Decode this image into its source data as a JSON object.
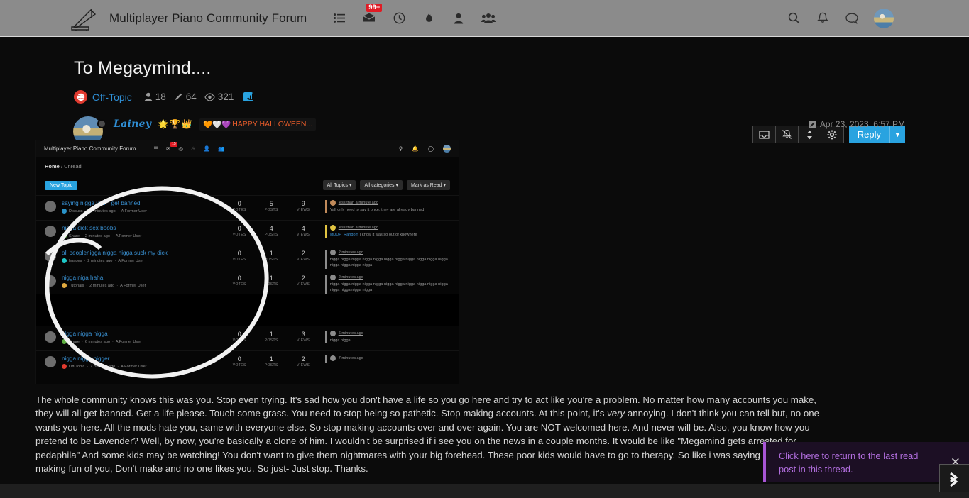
{
  "navbar": {
    "brand": "Multiplayer Piano Community Forum",
    "logo_icon": "piano-icon",
    "icons": [
      {
        "name": "list-icon",
        "glyph": "☰"
      },
      {
        "name": "unread-inbox-icon",
        "glyph": "✉",
        "badge": "99+"
      },
      {
        "name": "recent-clock-icon",
        "glyph": "◷"
      },
      {
        "name": "popular-flame-icon",
        "glyph": "♣"
      },
      {
        "name": "user-icon",
        "glyph": "●"
      },
      {
        "name": "groups-icon",
        "glyph": "●"
      }
    ],
    "right_icons": [
      {
        "name": "search-icon",
        "glyph": "⚲"
      },
      {
        "name": "notifications-bell-icon",
        "glyph": "␇"
      },
      {
        "name": "chat-icon",
        "glyph": "◯"
      }
    ],
    "avatar_alt": "user-avatar"
  },
  "topic": {
    "title": "To Megaymind....",
    "category": "Off-Topic",
    "category_color": "#e03a2f",
    "stats": {
      "posters_label": "18",
      "posts_label": "64",
      "views_label": "321"
    },
    "rss_label": "rss-feed"
  },
  "toolbar": {
    "buttons": [
      {
        "name": "topic-inbox-button",
        "glyph": "▱"
      },
      {
        "name": "unwatch-bell-slash-button",
        "glyph": "␇"
      },
      {
        "name": "sort-button",
        "glyph": "⇅"
      },
      {
        "name": "settings-gear-button",
        "glyph": "⚙"
      }
    ],
    "reply_label": "Reply",
    "reply_caret": "▼"
  },
  "post": {
    "username": "Lainey",
    "username_emoji": "🌟🏆👑",
    "user_title_hearts": "🧡🤍💜",
    "user_title": "HAPPY HALLOWEEN...",
    "date": "Apr 23, 2023, 6:57 PM",
    "edit_icon": "edit-pencil-icon",
    "status": "offline",
    "text_p1": "The whole community knows this was you. Stop even trying. It's sad how you don't have a life so you go here and try to act like you're a problem. No matter how many accounts you make, they will all get banned. Get a life please. Touch some grass. You need to stop being so pathetic. Stop making accounts. At this point, it's ",
    "text_em": "very",
    "text_p2": " annoying. I don't think you can tell but, no one wants you here. All the mods hate you, same with everyone else. So stop making accounts over and over again. You are NOT welcomed here. And never will be. Also, you know how you pretend to be Lavender? Well, by now, you're basically a clone of him. I wouldn't be surprised if i see you on the news in a couple months. It would be like \"Megamind gets arrested for pedaphila\" And some kids may be watching! You don't want to give them nightmares with your big forehead. These poor kids would have to go to therapy. So like i was saying before i started making fun of you, Don't make and no one likes you. So just- Just stop. Thanks."
  },
  "embedded_image": {
    "brand": "Multiplayer Piano Community Forum",
    "inbox_badge": "15",
    "breadcrumb_home": "Home",
    "breadcrumb_sep": "/",
    "breadcrumb_current": "Unread",
    "new_topic_label": "New Topic",
    "filters": [
      "All Topics ▾",
      "All categories ▾",
      "Mark as Read ▾"
    ],
    "count_labels": {
      "votes": "VOTES",
      "posts": "POSTS",
      "views": "VIEWS"
    },
    "rows": [
      {
        "title": "saying nigga until i get banned",
        "category": "Discuss",
        "category_color": "#2a93c9",
        "time": "13 minutes ago",
        "author": "A Former User",
        "votes": "0",
        "posts": "5",
        "views": "9",
        "reply_time": "less than a minute ago",
        "reply_text": "Yall only need to say it once, they are already banned",
        "reply_accent": "#c08a5a",
        "reply_mention": ""
      },
      {
        "title": "nigga dick sex boobs",
        "category": "Share",
        "category_color": "#5eb040",
        "time": "2 minutes ago",
        "author": "A Former User",
        "votes": "0",
        "posts": "4",
        "views": "4",
        "reply_time": "less than a minute ago",
        "reply_text": " I know it was so out of knowhere",
        "reply_accent": "#e0c341",
        "reply_mention": "@JDP_Random"
      },
      {
        "title": "all peoplenigga nigga nigga suck my dick",
        "category": "Images",
        "category_color": "#1ec7c7",
        "time": "2 minutes ago",
        "author": "A Former User",
        "votes": "0",
        "posts": "1",
        "views": "2",
        "reply_time": "2 minutes ago",
        "reply_text": "nigga nigga nigga nigga nigga nigga nigga nigga nigga nigga nigga nigga nigga nigga nigga",
        "reply_accent": "#8c8c8c",
        "reply_mention": ""
      },
      {
        "title": "nigga niga haha",
        "category": "Tutorials",
        "category_color": "#e0a93f",
        "time": "2 minutes ago",
        "author": "A Former User",
        "votes": "0",
        "posts": "1",
        "views": "2",
        "reply_time": "2 minutes ago",
        "reply_text": "nigga nigga nigga nigga nigga nigga nigga nigga nigga nigga nigga nigga nigga nigga nigga",
        "reply_accent": "#8c8c8c",
        "reply_mention": ""
      },
      {
        "title": "nigga nigga nigga",
        "category": "Share",
        "category_color": "#5eb040",
        "time": "6 minutes ago",
        "author": "A Former User",
        "votes": "0",
        "posts": "1",
        "views": "3",
        "reply_time": "6 minutes ago",
        "reply_text": "nigga nigga",
        "reply_accent": "#8c8c8c",
        "reply_mention": ""
      },
      {
        "title": "nigga nigga nigger",
        "category": "Off-Topic",
        "category_color": "#e03a2f",
        "time": "7 minutes ago",
        "author": "A Former User",
        "votes": "0",
        "posts": "1",
        "views": "2",
        "reply_time": "7 minutes ago",
        "reply_text": "",
        "reply_accent": "#8c8c8c",
        "reply_mention": ""
      }
    ]
  },
  "toast": {
    "message": "Click here to return to the last read post in this thread.",
    "close_icon": "close-icon",
    "accent": "#a855d6"
  },
  "scroll_bottom_icon": "double-chevron-down-icon"
}
